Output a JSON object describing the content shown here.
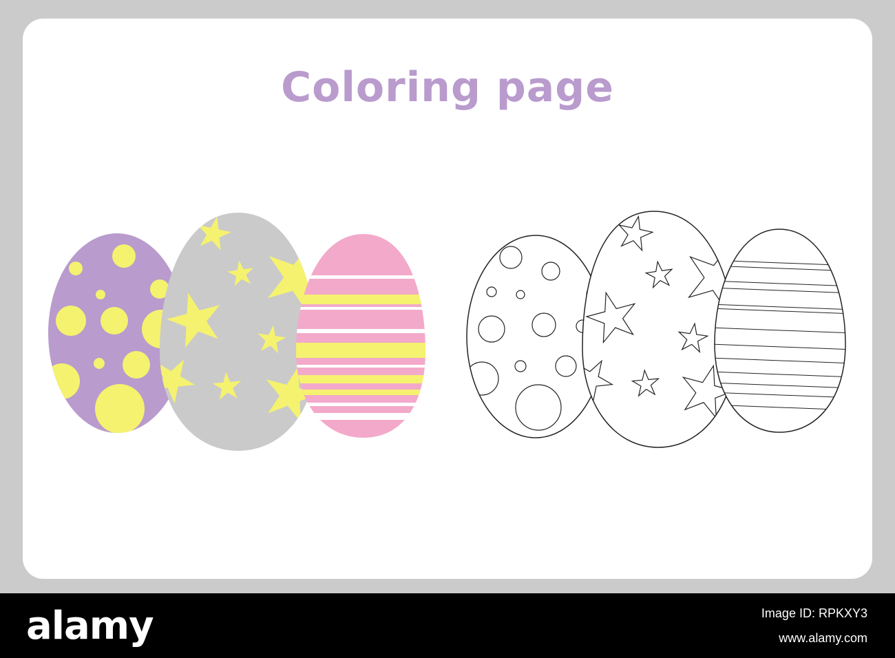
{
  "page": {
    "title": "Coloring page",
    "colors": {
      "background": "#cbcbcb",
      "sheet": "#ffffff",
      "title": "#b99bcd",
      "egg_purple": "#b99bcd",
      "egg_gray": "#cacaca",
      "egg_pink": "#f3a9ca",
      "pattern_yellow": "#f5f26f",
      "outline": "#222222"
    },
    "icons": {
      "colored_eggs": [
        "polka-dot-egg-icon",
        "star-egg-icon",
        "striped-egg-icon"
      ],
      "outline_eggs": [
        "polka-dot-egg-outline-icon",
        "star-egg-outline-icon",
        "striped-egg-outline-icon"
      ]
    }
  },
  "watermark": {
    "logo": "alamy",
    "line1": "Image ID: RPKXY3",
    "line2": "www.alamy.com"
  }
}
